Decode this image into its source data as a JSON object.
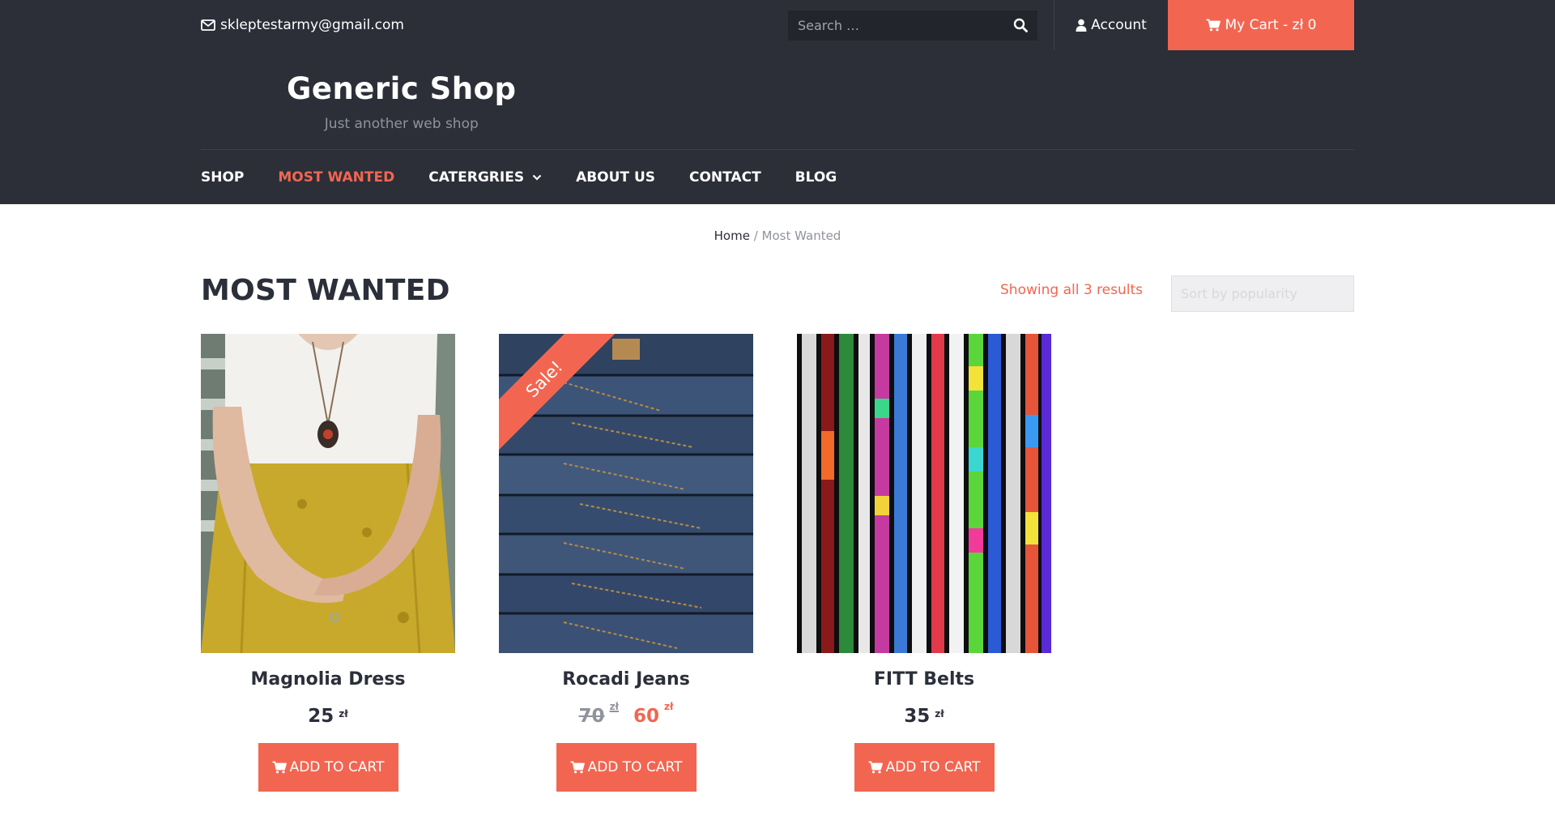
{
  "topbar": {
    "email": "skleptestarmy@gmail.com",
    "search_placeholder": "Search …",
    "account_label": "Account",
    "cart_label": "My Cart - zł 0"
  },
  "header": {
    "site_title": "Generic Shop",
    "tagline": "Just another web shop"
  },
  "nav": {
    "items": [
      {
        "label": "SHOP"
      },
      {
        "label": "MOST WANTED"
      },
      {
        "label": "CATERGRIES"
      },
      {
        "label": "ABOUT US"
      },
      {
        "label": "CONTACT"
      },
      {
        "label": "BLOG"
      }
    ],
    "active": "MOST WANTED"
  },
  "breadcrumb": {
    "home": "Home",
    "separator": " / ",
    "current": "Most Wanted"
  },
  "page": {
    "title": "MOST WANTED",
    "result_count": "Showing all 3 results",
    "orderby_selected": "Sort by popularity"
  },
  "products": [
    {
      "name": "Magnolia Dress",
      "price": "25",
      "currency": "zł",
      "button": "ADD TO CART"
    },
    {
      "name": "Rocadi Jeans",
      "old_price": "70",
      "price": "60",
      "currency": "zł",
      "badge": "Sale!",
      "button": "ADD TO CART"
    },
    {
      "name": "FITT Belts",
      "price": "35",
      "currency": "zł",
      "button": "ADD TO CART"
    }
  ],
  "colors": {
    "accent": "#f26651",
    "dark": "#2c2f38",
    "text": "#2b2f3a"
  }
}
